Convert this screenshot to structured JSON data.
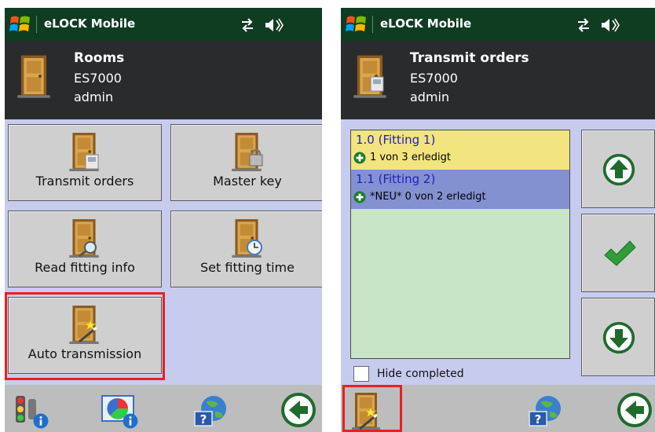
{
  "colors": {
    "titlebar": "#0f3d21",
    "header": "#2a2b2d",
    "panel": "#c7ccef",
    "tile": "#cfcfcf",
    "highlight": "#e8201e",
    "list_bg": "#c8e6c7",
    "item_yellow": "#f2e47e",
    "item_blue": "#8391d1"
  },
  "left": {
    "titlebar": {
      "app_title": "eLOCK Mobile",
      "icons": [
        "windows-start-icon",
        "connectivity-icon",
        "volume-icon"
      ]
    },
    "header": {
      "title": "Rooms",
      "line2": "ES7000",
      "line3": "admin",
      "icon": "door-icon"
    },
    "tiles": [
      {
        "label": "Transmit orders",
        "icon": "door-transmit-icon"
      },
      {
        "label": "Master key",
        "icon": "door-lock-icon"
      },
      {
        "label": "Read fitting info",
        "icon": "door-read-icon"
      },
      {
        "label": "Set fitting time",
        "icon": "door-clock-icon"
      },
      {
        "label": "Auto transmission",
        "icon": "door-wand-icon",
        "highlighted": true
      }
    ],
    "bottombar": [
      "traffic-light-info-icon",
      "chart-info-icon",
      "globe-help-icon",
      "back-arrow-icon"
    ]
  },
  "right": {
    "titlebar": {
      "app_title": "eLOCK Mobile",
      "icons": [
        "windows-start-icon",
        "connectivity-icon",
        "volume-icon"
      ]
    },
    "header": {
      "title": "Transmit orders",
      "line2": "ES7000",
      "line3": "admin",
      "icon": "door-transmit-icon"
    },
    "list": [
      {
        "title": "1.0 (Fitting 1)",
        "sub": "1 von 3 erledigt"
      },
      {
        "title": "1.1 (Fitting 2)",
        "sub": "*NEU*  0 von 2 erledigt"
      }
    ],
    "side_buttons": [
      "up-arrow-icon",
      "checkmark-icon",
      "down-arrow-icon"
    ],
    "hide_completed": {
      "label": "Hide completed",
      "checked": false
    },
    "bottombar": [
      "door-wand-icon",
      "globe-help-icon",
      "back-arrow-icon"
    ]
  }
}
